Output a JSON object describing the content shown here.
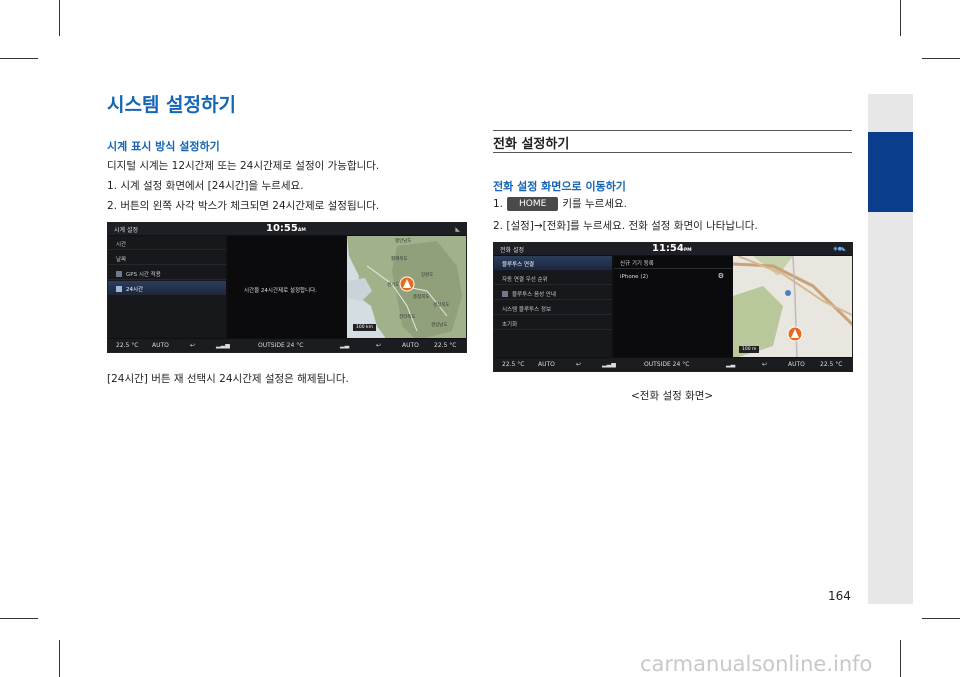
{
  "title": "시스템 설정하기",
  "left": {
    "subtitle": "시계 표시 방식 설정하기",
    "desc": "디지털 시계는 12시간제 또는 24시간제로 설정이 가능합니다.",
    "step1": "1. 시계 설정 화면에서 [24시간]을 누르세요.",
    "step2": "2. 버튼의 왼쪽 사각 박스가 체크되면 24시간제로 설정됩니다.",
    "note": "[24시간] 버튼 재 선택시 24시간제 설정은 해제됩니다."
  },
  "right": {
    "section_title": "전화 설정하기",
    "subtitle": "전화 설정 화면으로 이동하기",
    "step1_prefix": "1.",
    "home_key": "HOME",
    "step1_suffix": "키를 누르세요.",
    "step2": "2. [설정]→[전화]를 누르세요. 전화 설정 화면이 나타납니다.",
    "caption": "<전화 설정 화면>"
  },
  "screen1": {
    "title": "시계 설정",
    "time": "10:55",
    "ampm": "AM",
    "menu": [
      "시간",
      "날짜",
      "GPS 시간 적용",
      "24시간"
    ],
    "message": "시간을 24시간제로 설정합니다.",
    "map_labels": [
      "평안남도",
      "황해북도",
      "강원도",
      "경기도",
      "충청북도",
      "경상북도",
      "전라북도",
      "경상남도"
    ],
    "scale": "100 km",
    "bottom": {
      "temp_left": "22.5 °C",
      "auto_left": "AUTO",
      "outside": "OUTSIDE  24 °C",
      "auto_right": "AUTO",
      "temp_right": "22.5 °C"
    }
  },
  "screen2": {
    "title": "전화 설정",
    "time": "11:54",
    "ampm": "PM",
    "menu": [
      "블루투스 연결",
      "자동 연결 우선 순위",
      "블루투스 음성 안내",
      "시스템 블루투스 정보",
      "초기화"
    ],
    "center_items": [
      "신규 기기 등록",
      "iPhone (2)"
    ],
    "scale": "100 m",
    "bottom": {
      "temp_left": "22.5 °C",
      "auto_left": "AUTO",
      "outside": "OUTSIDE  24 °C",
      "auto_right": "AUTO",
      "temp_right": "22.5 °C"
    }
  },
  "page_number": "164",
  "watermark": "carmanualsonline.info",
  "colors": {
    "accent": "#1565b5",
    "tab": "#0a3d8c",
    "sidebar": "#e7e7e7"
  }
}
